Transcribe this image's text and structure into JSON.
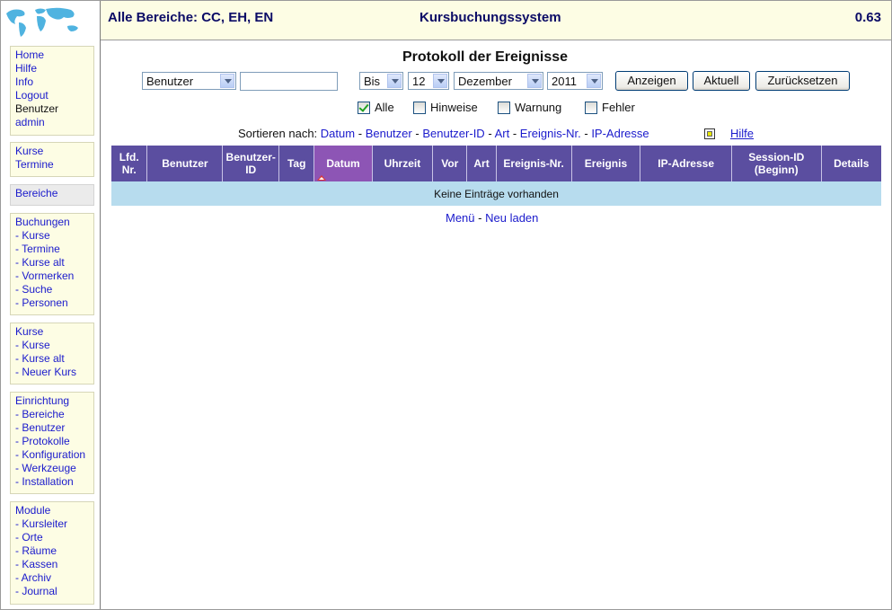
{
  "header": {
    "areas": "Alle Bereiche: CC, EH, EN",
    "app_title": "Kursbuchungssystem",
    "version": "0.63"
  },
  "sidebar": {
    "logo": "world-map-logo",
    "group1": [
      "Home",
      "Hilfe",
      "Info",
      "Logout",
      "Benutzer",
      "admin"
    ],
    "group2": [
      "Kurse",
      "Termine"
    ],
    "group3": [
      "Bereiche"
    ],
    "group4": [
      "Buchungen",
      "- Kurse",
      "- Termine",
      "- Kurse alt",
      "- Vormerken",
      "- Suche",
      "- Personen"
    ],
    "group5": [
      "Kurse",
      "- Kurse",
      "- Kurse alt",
      "- Neuer Kurs"
    ],
    "group6": [
      "Einrichtung",
      "- Bereiche",
      "- Benutzer",
      "- Protokolle",
      "- Konfiguration",
      "- Werkzeuge",
      "- Installation"
    ],
    "group7": [
      "Module",
      "- Kursleiter",
      "- Orte",
      "- Räume",
      "- Kassen",
      "- Archiv",
      "- Journal"
    ]
  },
  "main": {
    "title": "Protokoll der Ereignisse",
    "filter": {
      "field": "Benutzer",
      "text_value": "",
      "direction": "Bis",
      "month_num": "12",
      "month_name": "Dezember",
      "year": "2011"
    },
    "buttons": {
      "show": "Anzeigen",
      "current": "Aktuell",
      "reset": "Zurücksetzen"
    },
    "checkboxes": [
      {
        "label": "Alle",
        "checked": true
      },
      {
        "label": "Hinweise",
        "checked": false
      },
      {
        "label": "Warnung",
        "checked": false
      },
      {
        "label": "Fehler",
        "checked": false
      }
    ],
    "sort": {
      "prefix": "Sortieren nach:",
      "links": [
        "Datum",
        "Benutzer",
        "Benutzer-ID",
        "Art",
        "Ereignis-Nr.",
        "IP-Adresse"
      ],
      "separator": "-",
      "help": "Hilfe"
    },
    "table": {
      "columns": [
        "Lfd. Nr.",
        "Benutzer",
        "Benutzer-ID",
        "Tag",
        "Datum",
        "Uhrzeit",
        "Vor",
        "Art",
        "Ereignis-Nr.",
        "Ereignis",
        "IP-Adresse",
        "Session-ID (Beginn)",
        "Details"
      ],
      "active_column": "Datum",
      "empty_message": "Keine Einträge vorhanden"
    },
    "footer_links": {
      "menu": "Menü",
      "separator": "-",
      "reload": "Neu laden"
    }
  },
  "colors": {
    "header_bg": "#fdfde4",
    "table_header": "#5b4ea0",
    "active_header": "#8d55b5",
    "empty_row": "#b7dcee",
    "link": "#1a1acc"
  }
}
